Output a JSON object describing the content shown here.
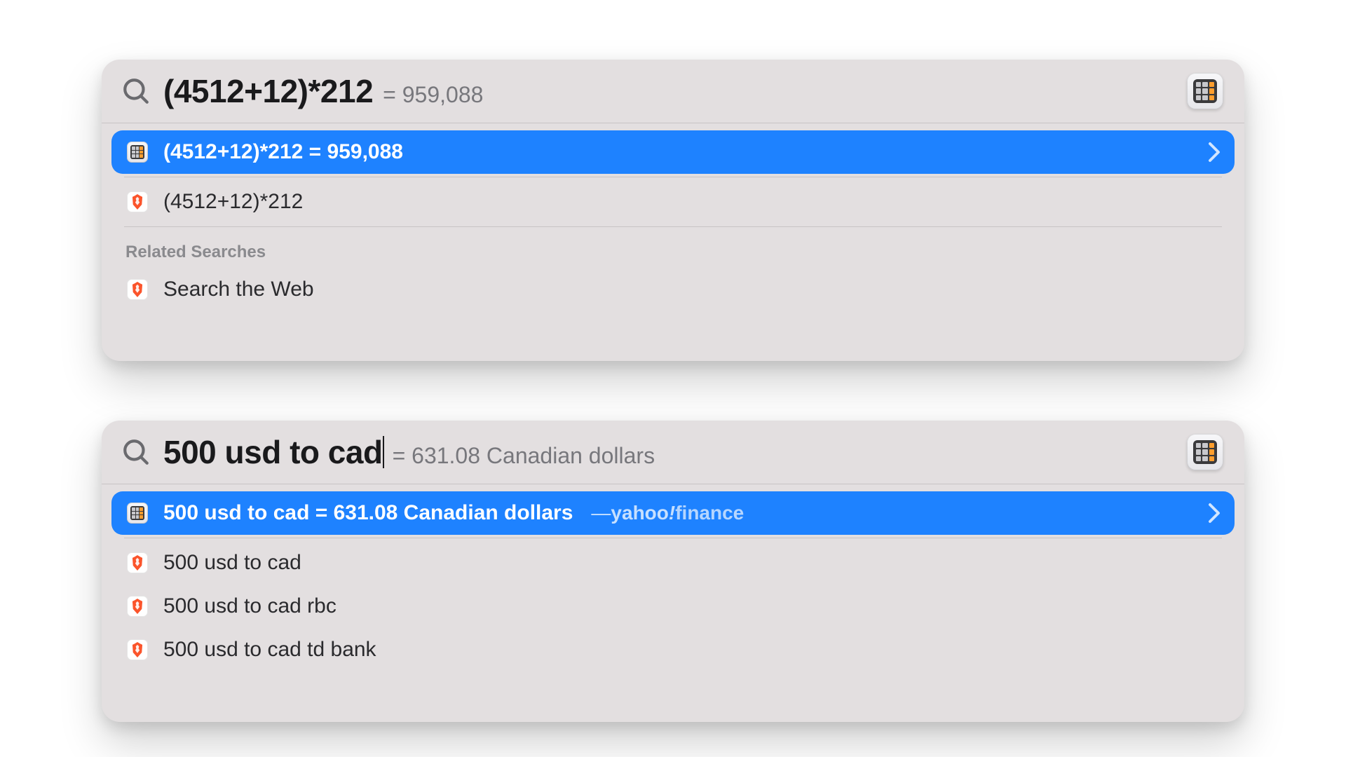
{
  "panel1": {
    "query": "(4512+12)*212",
    "inline_result": "= 959,088",
    "selected": {
      "icon": "calculator",
      "text": "(4512+12)*212 = 959,088"
    },
    "rows": [
      {
        "icon": "brave",
        "text": "(4512+12)*212"
      }
    ],
    "section_header": "Related Searches",
    "related": [
      {
        "icon": "brave",
        "text": "Search the Web"
      }
    ]
  },
  "panel2": {
    "query": "500 usd to cad",
    "inline_result": "= 631.08 Canadian dollars",
    "selected": {
      "icon": "calculator",
      "text": "500 usd to cad = 631.08 Canadian dollars",
      "attribution_brand": "yahoo",
      "attribution_sub": "finance"
    },
    "rows": [
      {
        "icon": "brave",
        "text": "500 usd to cad"
      },
      {
        "icon": "brave",
        "text": "500 usd to cad rbc"
      },
      {
        "icon": "brave",
        "text": "500 usd to cad td bank"
      }
    ]
  }
}
